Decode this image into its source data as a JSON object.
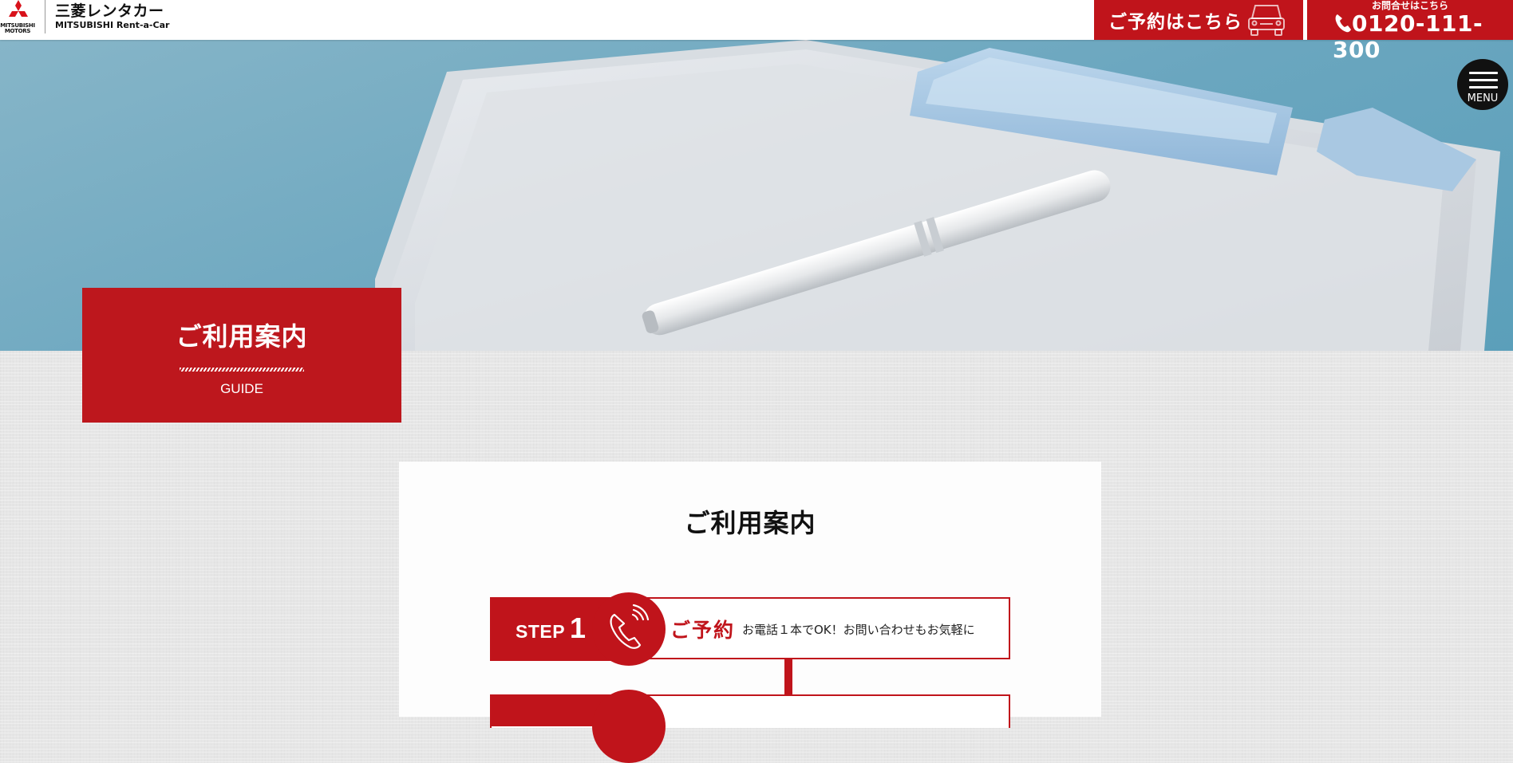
{
  "header": {
    "brand_name_ja": "三菱レンタカー",
    "brand_name_en": "MITSUBISHI Rent-a-Car",
    "maker_logo_text_1": "MITSUBISHI",
    "maker_logo_text_2": "MOTORS",
    "reserve_label": "ご予約はこちら",
    "phone_caption": "お問合せはこちら",
    "phone_number": "0120-111-300"
  },
  "menu": {
    "label": "MENU"
  },
  "hero": {
    "title_ja": "ご利用案内",
    "title_en": "GUIDE"
  },
  "content": {
    "section_title": "ご利用案内",
    "steps": [
      {
        "step_word": "STEP",
        "number": "1",
        "icon": "phone-icon",
        "name": "ご予約",
        "description": "お電話１本でOK！お問い合わせもお気軽に"
      }
    ]
  },
  "colors": {
    "brand_red": "#c0141b",
    "hero_sky": "#6aa6bf",
    "page_bg": "#e6e6e6"
  }
}
